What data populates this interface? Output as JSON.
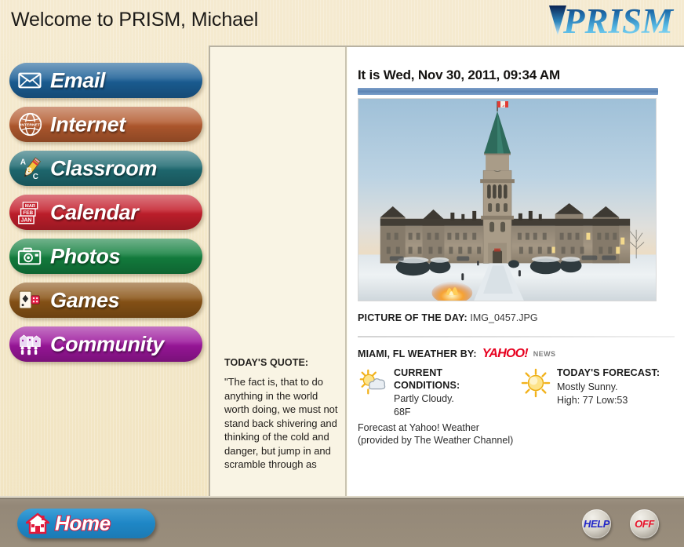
{
  "header": {
    "welcome": "Welcome to PRISM, Michael",
    "brand": "PRISM",
    "brand_icon": "prism-triangle-icon",
    "brand_gradient_dark": "#0d2a5e",
    "brand_gradient_light": "#7fd4f2"
  },
  "sidebar": {
    "items": [
      {
        "label": "Email",
        "icon": "envelope-icon",
        "color": "#1b5f96"
      },
      {
        "label": "Internet",
        "icon": "globe-internet-icon",
        "color": "#b35a2e"
      },
      {
        "label": "Classroom",
        "icon": "abc-pencil-icon",
        "color": "#1f6b72"
      },
      {
        "label": "Calendar",
        "icon": "calendar-months-icon",
        "color": "#c41f2c"
      },
      {
        "label": "Photos",
        "icon": "camera-icon",
        "color": "#13803f"
      },
      {
        "label": "Games",
        "icon": "cards-dice-icon",
        "color": "#8a5416"
      },
      {
        "label": "Community",
        "icon": "people-buildings-icon",
        "color": "#9c169c"
      }
    ]
  },
  "main": {
    "date_line": "It is Wed, Nov 30, 2011, 09:34 AM",
    "picture_of_day": {
      "label": "PICTURE OF THE DAY:",
      "filename": "IMG_0457.JPG",
      "description": "Canadian Parliament building at dusk in winter snow"
    },
    "quote": {
      "heading": "TODAY'S QUOTE:",
      "text": "\"The fact is, that to do anything in the world worth doing, we must not stand back shivering and thinking of the cold and danger, but jump in and scramble through as"
    },
    "weather": {
      "city_label": "MIAMI, FL WEATHER BY:",
      "source_wordmark": "YAHOO!",
      "source_suffix": "NEWS",
      "source_color": "#e7001f",
      "current": {
        "heading": "CURRENT CONDITIONS:",
        "condition": "Partly Cloudy.",
        "temperature": "68F",
        "icon": "sun-behind-cloud-icon"
      },
      "forecast": {
        "heading": "TODAY'S FORECAST:",
        "condition": "Mostly Sunny.",
        "high_low": "High: 77 Low:53",
        "icon": "sun-icon"
      },
      "credit_line_1": "Forecast at Yahoo! Weather",
      "credit_line_2": "(provided by The Weather Channel)"
    }
  },
  "footer": {
    "home_label": "Home",
    "home_icon": "house-icon",
    "help_label": "HELP",
    "off_label": "OFF"
  }
}
